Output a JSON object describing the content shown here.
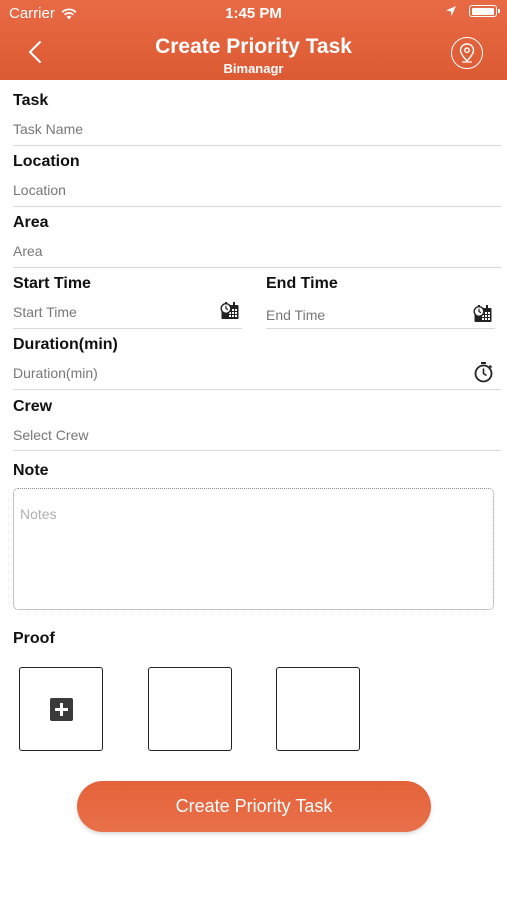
{
  "status_bar": {
    "carrier": "Carrier",
    "time": "1:45 PM"
  },
  "nav": {
    "title": "Create Priority Task",
    "subtitle": "Bimanagr"
  },
  "form": {
    "task": {
      "label": "Task",
      "placeholder": "Task Name"
    },
    "location": {
      "label": "Location",
      "placeholder": "Location"
    },
    "area": {
      "label": "Area",
      "placeholder": "Area"
    },
    "start_time": {
      "label": "Start Time",
      "placeholder": "Start Time"
    },
    "end_time": {
      "label": "End Time",
      "placeholder": "End Time"
    },
    "duration": {
      "label": "Duration(min)",
      "placeholder": "Duration(min)"
    },
    "crew": {
      "label": "Crew",
      "placeholder": "Select Crew"
    },
    "note": {
      "label": "Note",
      "placeholder": "Notes"
    },
    "proof": {
      "label": "Proof"
    }
  },
  "submit_label": "Create Priority Task",
  "colors": {
    "accent": "#e2633c",
    "divider": "#d8d8d8",
    "placeholder": "#777777"
  }
}
